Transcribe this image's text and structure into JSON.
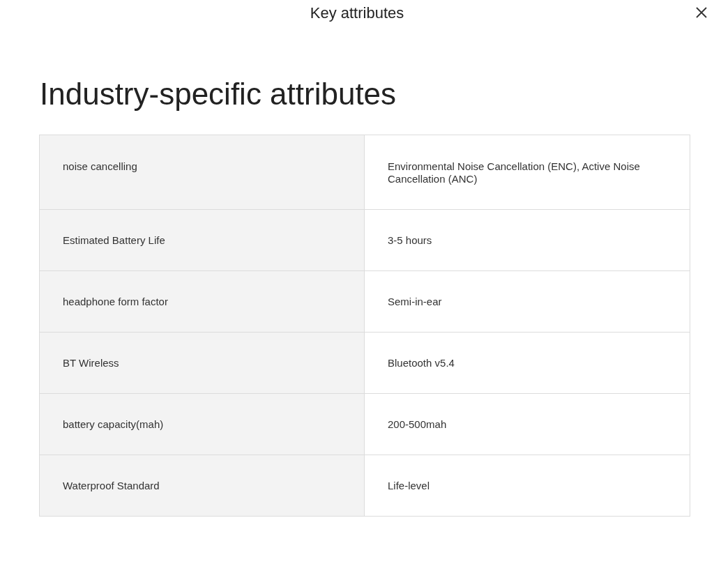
{
  "dialog": {
    "title": "Key attributes"
  },
  "section": {
    "heading": "Industry-specific attributes"
  },
  "table": {
    "rows": [
      {
        "name": "noise cancelling",
        "value": "Environmental Noise Cancellation (ENC), Active Noise Cancellation (ANC)"
      },
      {
        "name": "Estimated Battery Life",
        "value": "3-5 hours"
      },
      {
        "name": "headphone form factor",
        "value": "Semi-in-ear"
      },
      {
        "name": "BT Wireless",
        "value": "Bluetooth v5.4"
      },
      {
        "name": "battery capacity(mah)",
        "value": "200-500mah"
      },
      {
        "name": "Waterproof Standard",
        "value": "Life-level"
      }
    ]
  }
}
